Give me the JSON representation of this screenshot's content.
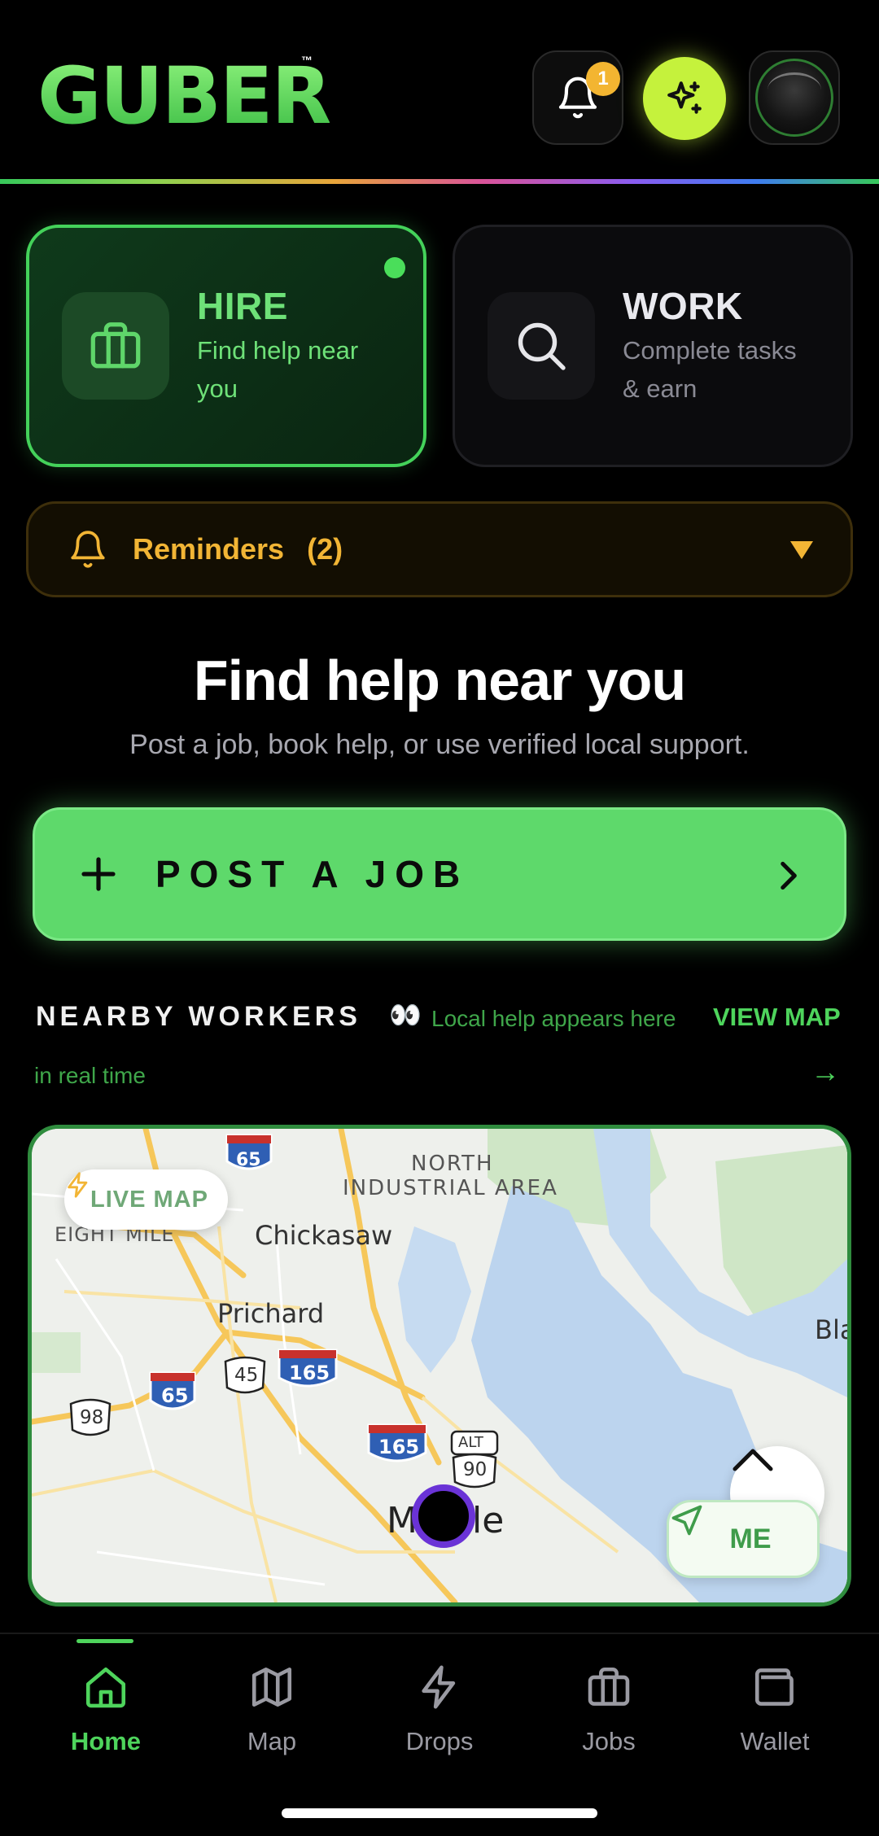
{
  "header": {
    "logo": "GUBER",
    "trademark": "™",
    "notifications_badge": "1",
    "brand_green": "#58d964",
    "ai_button_color": "#c5f23c"
  },
  "modes": {
    "hire": {
      "title": "HIRE",
      "subtitle": "Find help near you",
      "icon": "briefcase-icon",
      "active": true
    },
    "work": {
      "title": "WORK",
      "subtitle": "Complete tasks & earn",
      "icon": "search-icon",
      "active": false
    }
  },
  "reminders": {
    "label": "Reminders",
    "count": "(2)",
    "accent": "#f2b535"
  },
  "hero": {
    "title": "Find help near you",
    "subtitle": "Post a job, book help, or use verified local support."
  },
  "post_job": {
    "label": "POST A JOB"
  },
  "nearby": {
    "title": "NEARBY WORKERS",
    "emoji": "👀",
    "hint_line1": "Local help appears here",
    "hint_line2": "in real time",
    "view_map": "VIEW MAP",
    "arrow": "→"
  },
  "map": {
    "live_label": "LIVE MAP",
    "labels": {
      "north_industrial": "NORTH",
      "industrial_area": "INDUSTRIAL AREA",
      "eight_mile": "EIGHT MILE",
      "chickasaw": "Chickasaw",
      "prichard": "Prichard",
      "mobile": "Mobile",
      "bla": "Bla"
    },
    "shields": {
      "i65_top": "65",
      "i165_a": "165",
      "i65": "65",
      "us45": "45",
      "us98": "98",
      "i165_b": "165",
      "alt": "ALT",
      "us90": "90"
    },
    "me_label": "ME"
  },
  "nav": {
    "items": [
      {
        "label": "Home",
        "icon": "home-icon",
        "active": true
      },
      {
        "label": "Map",
        "icon": "map-icon",
        "active": false
      },
      {
        "label": "Drops",
        "icon": "bolt-icon",
        "active": false
      },
      {
        "label": "Jobs",
        "icon": "briefcase-icon",
        "active": false
      },
      {
        "label": "Wallet",
        "icon": "wallet-icon",
        "active": false
      }
    ]
  }
}
